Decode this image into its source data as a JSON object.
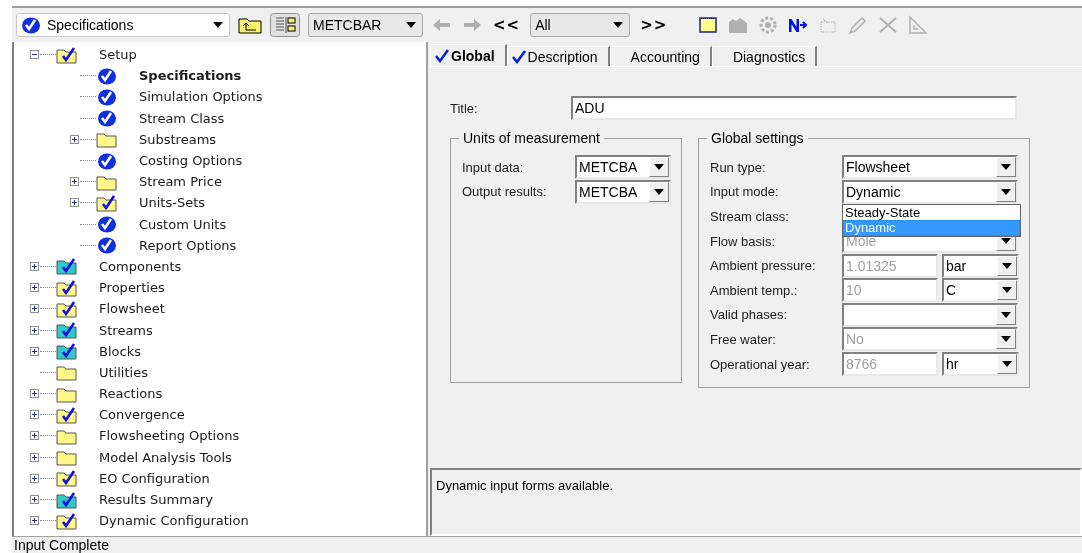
{
  "toolbar": {
    "form_selector": {
      "value": "Specifications"
    },
    "units_selector": {
      "value": "METCBAR"
    },
    "prev_label": "<<",
    "next_label": ">>",
    "filter": {
      "value": "All"
    },
    "buttons": [
      {
        "kind": "back",
        "disabled": true
      },
      {
        "kind": "forward",
        "disabled": true
      }
    ],
    "tools": [
      {
        "kind": "note",
        "disabled": false
      },
      {
        "kind": "picture",
        "disabled": true
      },
      {
        "kind": "gear",
        "disabled": true
      },
      {
        "kind": "next",
        "disabled": false
      },
      {
        "kind": "clip",
        "disabled": true
      },
      {
        "kind": "pencil",
        "disabled": true
      },
      {
        "kind": "delete",
        "disabled": true
      },
      {
        "kind": "ruler",
        "disabled": true
      }
    ]
  },
  "tree": [
    {
      "label": "Setup",
      "kind": "folder_check",
      "expanded": true,
      "selected": false,
      "children": [
        {
          "label": "Specifications",
          "kind": "check",
          "selected": true
        },
        {
          "label": "Simulation Options",
          "kind": "check",
          "selected": false
        },
        {
          "label": "Stream Class",
          "kind": "check",
          "selected": false
        },
        {
          "label": "Substreams",
          "kind": "folder",
          "expanded": false,
          "selected": false
        },
        {
          "label": "Costing Options",
          "kind": "check",
          "selected": false
        },
        {
          "label": "Stream Price",
          "kind": "folder",
          "expanded": false,
          "selected": false
        },
        {
          "label": "Units-Sets",
          "kind": "folder_check",
          "expanded": false,
          "selected": false
        },
        {
          "label": "Custom Units",
          "kind": "check",
          "selected": false
        },
        {
          "label": "Report Options",
          "kind": "check",
          "selected": false
        }
      ]
    },
    {
      "label": "Components",
      "kind": "teal_folder_check",
      "expanded": false,
      "selected": false
    },
    {
      "label": "Properties",
      "kind": "folder_check",
      "expanded": false,
      "selected": false
    },
    {
      "label": "Flowsheet",
      "kind": "folder_check",
      "expanded": false,
      "selected": false
    },
    {
      "label": "Streams",
      "kind": "teal_folder_check",
      "expanded": false,
      "selected": false
    },
    {
      "label": "Blocks",
      "kind": "teal_folder_check",
      "expanded": false,
      "selected": false
    },
    {
      "label": "Utilities",
      "kind": "folder",
      "selected": false
    },
    {
      "label": "Reactions",
      "kind": "folder",
      "expanded": false,
      "selected": false
    },
    {
      "label": "Convergence",
      "kind": "folder_check",
      "expanded": false,
      "selected": false
    },
    {
      "label": "Flowsheeting Options",
      "kind": "folder",
      "expanded": false,
      "selected": false
    },
    {
      "label": "Model Analysis Tools",
      "kind": "folder",
      "expanded": false,
      "selected": false
    },
    {
      "label": "EO Configuration",
      "kind": "folder_check",
      "expanded": false,
      "selected": false
    },
    {
      "label": "Results Summary",
      "kind": "teal_folder_check",
      "expanded": false,
      "selected": false
    },
    {
      "label": "Dynamic Configuration",
      "kind": "folder_check",
      "expanded": false,
      "selected": false
    }
  ],
  "tabs": [
    {
      "label": "Global",
      "checked": true,
      "selected": true
    },
    {
      "label": "Description",
      "checked": true,
      "selected": false
    },
    {
      "label": "Accounting",
      "checked": false,
      "selected": false
    },
    {
      "label": "Diagnostics",
      "checked": false,
      "selected": false
    }
  ],
  "form": {
    "title": {
      "label": "Title:",
      "value": "ADU"
    },
    "units_group": {
      "title": "Units of measurement",
      "rows": [
        {
          "label": "Input data:",
          "value": "METCBA"
        },
        {
          "label": "Output results:",
          "value": "METCBA"
        }
      ]
    },
    "global_group": {
      "title": "Global settings",
      "rows": [
        {
          "label": "Run type:",
          "value": "Flowsheet",
          "disabled": false
        },
        {
          "label": "Input mode:",
          "value": "Dynamic",
          "disabled": false,
          "open": true,
          "options": [
            {
              "label": "Steady-State",
              "selected": false
            },
            {
              "label": "Dynamic",
              "selected": true
            }
          ]
        },
        {
          "label": "Stream class:"
        },
        {
          "label": "Flow basis:",
          "value": "Mole",
          "disabled": true
        },
        {
          "label": "Ambient pressure:",
          "value": "1.01325",
          "disabled": true,
          "unit": "bar"
        },
        {
          "label": "Ambient temp.:",
          "value": "10",
          "disabled": true,
          "unit": "C"
        },
        {
          "label": "Valid phases:"
        },
        {
          "label": "Free water:",
          "value": "No",
          "disabled": true
        },
        {
          "label": "Operational year:",
          "value": "8766",
          "disabled": true,
          "unit": "hr"
        }
      ]
    }
  },
  "message": "Dynamic input forms available.",
  "status_bar": "Input Complete"
}
